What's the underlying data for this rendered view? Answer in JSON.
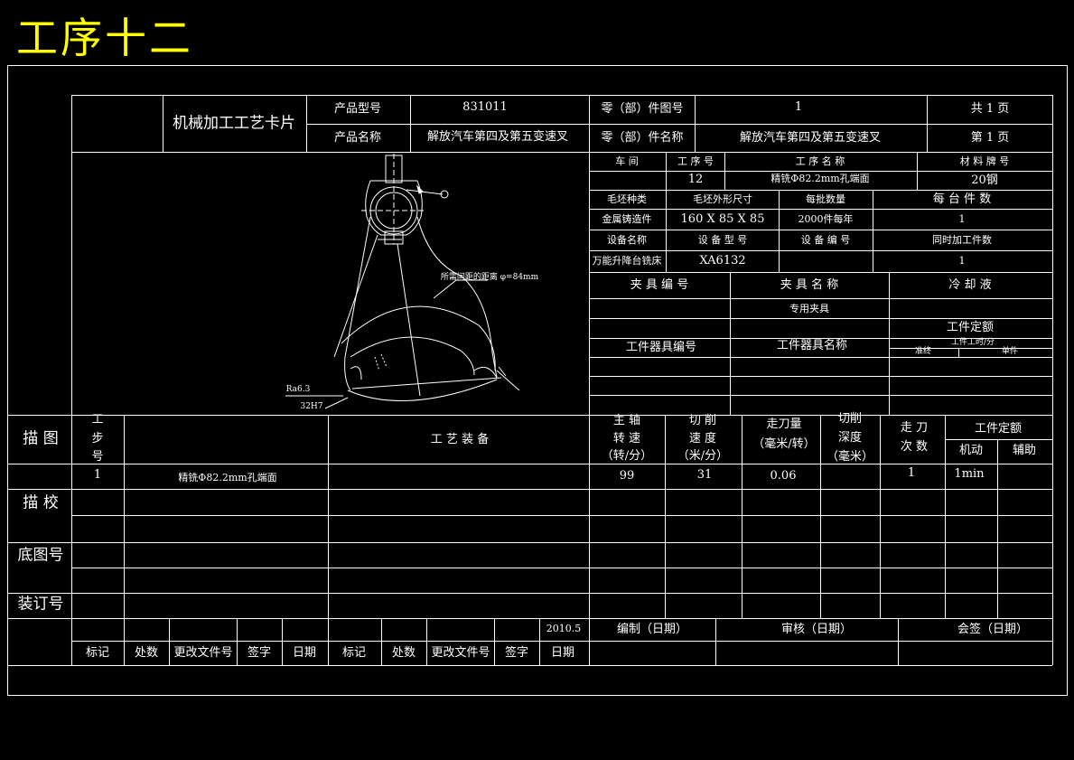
{
  "page_heading": "工序十二",
  "card_title": "机械加工工艺卡片",
  "header": {
    "product_model_label": "产品型号",
    "product_model_value": "831011",
    "part_drawing_no_label": "零（部）件图号",
    "part_drawing_no_value": "1",
    "total_pages_label": "共 1 页",
    "product_name_label": "产品名称",
    "product_name_value": "解放汽车第四及第五变速叉",
    "part_name_label": "零（部）件名称",
    "part_name_value": "解放汽车第四及第五变速叉",
    "page_no_label": "第 1 页"
  },
  "process_info": {
    "workshop_label": "车 间",
    "process_no_label": "工 序 号",
    "process_name_label": "工 序 名 称",
    "material_label": "材 料 牌 号",
    "process_no_value": "12",
    "process_name_value": "精铣Φ82.2mm孔端面",
    "material_value": "20钢",
    "blank_type_label": "毛坯种类",
    "blank_size_label": "毛坯外形尺寸",
    "batch_qty_label": "每批数量",
    "per_unit_qty_label": "每 台 件 数",
    "blank_type_value": "金属铸造件",
    "blank_size_value": "160 X 85 X 85",
    "batch_qty_value": "2000件每年",
    "per_unit_qty_value": "1",
    "equipment_name_label": "设备名称",
    "equipment_model_label": "设 备 型 号",
    "equipment_no_label": "设 备 编 号",
    "simultaneous_label": "同时加工件数",
    "equipment_name_value": "万能升降台铣床",
    "equipment_model_value": "XA6132",
    "simultaneous_value": "1",
    "fixture_no_label": "夹 具 编 号",
    "fixture_name_label": "夹 具 名 称",
    "coolant_label": "冷 却 液",
    "fixture_name_value": "专用夹具",
    "time_quota_label": "工件定额",
    "tool_no_label": "工件器具编号",
    "tool_name_label": "工件器具名称",
    "time_unit_label": "工件工时/分",
    "prep_label": "准终",
    "single_label": "单件"
  },
  "drawing_annotations": {
    "note_label": "所需间距的距离 φ=84mm",
    "label_a": "Ra6.3",
    "label_b": "32H7"
  },
  "side_labels": {
    "drawing": "描 图",
    "check": "描 校",
    "base_no": "底图号",
    "binding_no": "装订号"
  },
  "steps_table": {
    "step_label_chars": [
      "工",
      "步",
      "号"
    ],
    "equipment_label": "工 艺 装 备",
    "spindle_speed_label_lines": [
      "主 轴",
      "转 速",
      "（转/分）"
    ],
    "cutting_speed_label_lines": [
      "切 削",
      "速 度",
      "（米/分）"
    ],
    "feed_label_lines": [
      "走刀量",
      "（毫米/转）"
    ],
    "depth_label_lines": [
      "切削",
      "深度",
      "（毫米）"
    ],
    "passes_label_lines": [
      "走 刀",
      "次 数"
    ],
    "time_quota_label": "工件定额",
    "machine_time_label": "机动",
    "aux_time_label": "辅助",
    "rows": [
      {
        "step": "1",
        "content": "精铣Φ82.2mm孔端面",
        "spindle": "99",
        "cut_speed": "31",
        "feed": "0.06",
        "depth": "",
        "passes": "1",
        "machine_time": "1min",
        "aux_time": ""
      }
    ]
  },
  "signature": {
    "date_value": "2010.5",
    "compiled_label": "编制（日期）",
    "reviewed_label": "审核（日期）",
    "countersign_label": "会签（日期）",
    "mark_label": "标记",
    "count_label": "处数",
    "doc_no_label": "更改文件号",
    "sign_label": "签字",
    "date_label": "日期"
  }
}
